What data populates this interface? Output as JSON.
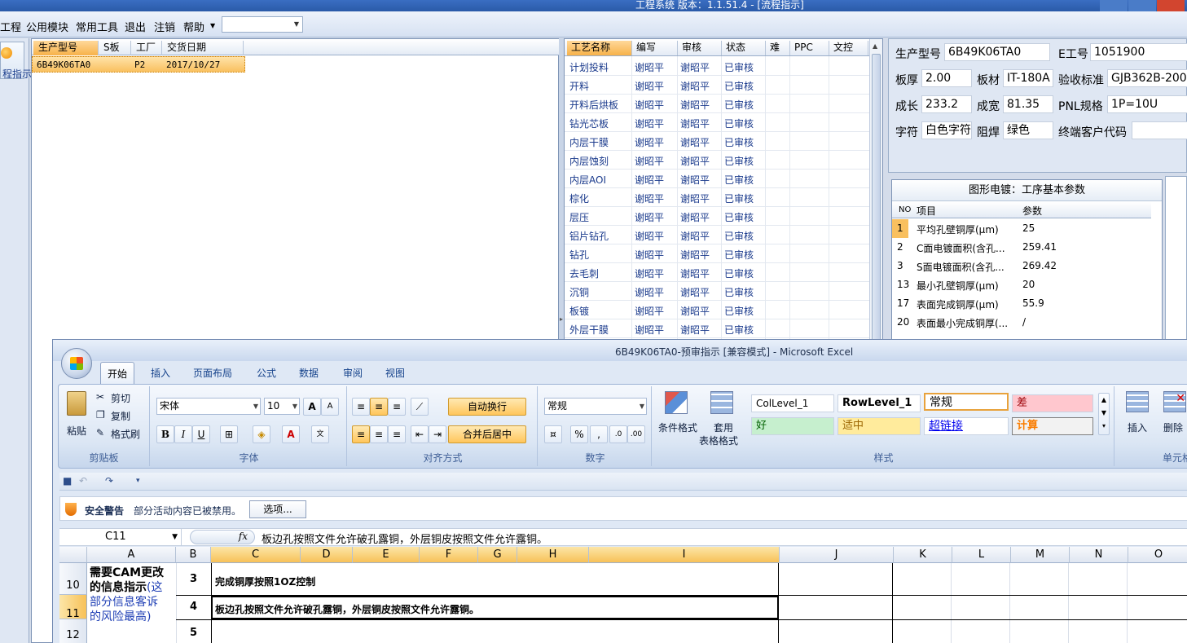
{
  "app": {
    "title": "工程系统   版本：1.1.51.4 - [流程指示]"
  },
  "menu": {
    "items": [
      "工程",
      "公用模块",
      "常用工具",
      "退出",
      "注销",
      "帮助"
    ],
    "combo_value": ""
  },
  "left_strip": {
    "button_label": "程指示"
  },
  "product_list": {
    "columns": [
      "生产型号",
      "S板",
      "工厂",
      "交货日期"
    ],
    "rows": [
      {
        "model": "6B49K06TA0",
        "s_board": "",
        "factory": "P2",
        "delivery": "2017/10/27"
      }
    ]
  },
  "process_grid": {
    "columns": [
      "工艺名称",
      "编写",
      "审核",
      "状态",
      "难",
      "PPC",
      "文控"
    ],
    "rows": [
      {
        "name": "计划投料",
        "writer": "谢昭平",
        "auditor": "谢昭平",
        "status": "已审核"
      },
      {
        "name": "开料",
        "writer": "谢昭平",
        "auditor": "谢昭平",
        "status": "已审核"
      },
      {
        "name": "开料后烘板",
        "writer": "谢昭平",
        "auditor": "谢昭平",
        "status": "已审核"
      },
      {
        "name": "钻光芯板",
        "writer": "谢昭平",
        "auditor": "谢昭平",
        "status": "已审核"
      },
      {
        "name": "内层干膜",
        "writer": "谢昭平",
        "auditor": "谢昭平",
        "status": "已审核"
      },
      {
        "name": "内层蚀刻",
        "writer": "谢昭平",
        "auditor": "谢昭平",
        "status": "已审核"
      },
      {
        "name": "内层AOI",
        "writer": "谢昭平",
        "auditor": "谢昭平",
        "status": "已审核"
      },
      {
        "name": "棕化",
        "writer": "谢昭平",
        "auditor": "谢昭平",
        "status": "已审核"
      },
      {
        "name": "层压",
        "writer": "谢昭平",
        "auditor": "谢昭平",
        "status": "已审核"
      },
      {
        "name": "铝片钻孔",
        "writer": "谢昭平",
        "auditor": "谢昭平",
        "status": "已审核"
      },
      {
        "name": "钻孔",
        "writer": "谢昭平",
        "auditor": "谢昭平",
        "status": "已审核"
      },
      {
        "name": "去毛刺",
        "writer": "谢昭平",
        "auditor": "谢昭平",
        "status": "已审核"
      },
      {
        "name": "沉铜",
        "writer": "谢昭平",
        "auditor": "谢昭平",
        "status": "已审核"
      },
      {
        "name": "板镀",
        "writer": "谢昭平",
        "auditor": "谢昭平",
        "status": "已审核"
      },
      {
        "name": "外层干膜",
        "writer": "谢昭平",
        "auditor": "谢昭平",
        "status": "已审核"
      }
    ]
  },
  "info": {
    "model_label": "生产型号",
    "model_value": "6B49K06TA0",
    "eno_label": "E工号",
    "eno_value": "1051900",
    "thick_label": "板厚",
    "thick_value": "2.00",
    "material_label": "板材",
    "material_value": "IT-180A",
    "std_label": "验收标准",
    "std_value": "GJB362B-2009",
    "len_label": "成长",
    "len_value": "233.2",
    "width_label": "成宽",
    "width_value": "81.35",
    "pnl_label": "PNL规格",
    "pnl_value": "1P=10U",
    "char_label": "字符",
    "char_value": "白色字符",
    "mask_label": "阻焊",
    "mask_value": "绿色",
    "cust_label": "终端客户代码",
    "cust_value": ""
  },
  "plating": {
    "title": "图形电镀：工序基本参数",
    "col_no": "NO",
    "col_item": "项目",
    "col_param": "参数",
    "rows": [
      {
        "no": "1",
        "item": "平均孔壁铜厚(μm)",
        "param": "25"
      },
      {
        "no": "2",
        "item": "C面电镀面积(含孔...",
        "param": "259.41"
      },
      {
        "no": "3",
        "item": "S面电镀面积(含孔...",
        "param": "269.42"
      },
      {
        "no": "13",
        "item": "最小孔壁铜厚(μm)",
        "param": "20"
      },
      {
        "no": "17",
        "item": "表面完成铜厚(μm)",
        "param": "55.9"
      },
      {
        "no": "20",
        "item": "表面最小完成铜厚(...",
        "param": "/"
      }
    ]
  },
  "excel": {
    "title": "6B49K06TA0-预审指示  [兼容模式] - Microsoft Excel",
    "tabs": [
      "开始",
      "插入",
      "页面布局",
      "公式",
      "数据",
      "审阅",
      "视图"
    ],
    "clipboard": {
      "paste": "粘贴",
      "cut": "剪切",
      "copy": "复制",
      "painter": "格式刷",
      "label": "剪贴板"
    },
    "font": {
      "name": "宋体",
      "size": "10",
      "label": "字体"
    },
    "align": {
      "wrap": "自动换行",
      "merge": "合并后居中",
      "label": "对齐方式"
    },
    "number": {
      "format": "常规",
      "label": "数字"
    },
    "styles": {
      "cond": "条件格式",
      "table_a": "套用",
      "table_b": "表格格式",
      "col_level": "ColLevel_1",
      "row_level": "RowLevel_1",
      "normal": "常规",
      "bad": "差",
      "good": "好",
      "neutral": "适中",
      "hyperlink": "超链接",
      "calc": "计算",
      "label": "样式"
    },
    "cells_group": {
      "insert": "插入",
      "delete": "删除",
      "label": "单元格"
    },
    "security": {
      "title": "安全警告",
      "message": "部分活动内容已被禁用。",
      "options": "选项..."
    },
    "name_box": "C11",
    "formula": "板边孔按照文件允许破孔露铜，外层铜皮按照文件允许露铜。",
    "columns": [
      "A",
      "B",
      "C",
      "D",
      "E",
      "F",
      "G",
      "H",
      "I",
      "J",
      "K",
      "L",
      "M",
      "N",
      "O"
    ],
    "rows": [
      "10",
      "11",
      "12"
    ],
    "a_text_1": "需要CAM更改",
    "a_text_2": "的信息指示",
    "a_text_3": "(这",
    "a_text_4": "部分信息客诉",
    "a_text_5": "的风险最高)",
    "b10": "3",
    "c10": "完成铜厚按照1OZ控制",
    "b11": "4",
    "c11": "板边孔按照文件允许破孔露铜，外层铜皮按照文件允许露铜。",
    "b12": "5"
  }
}
